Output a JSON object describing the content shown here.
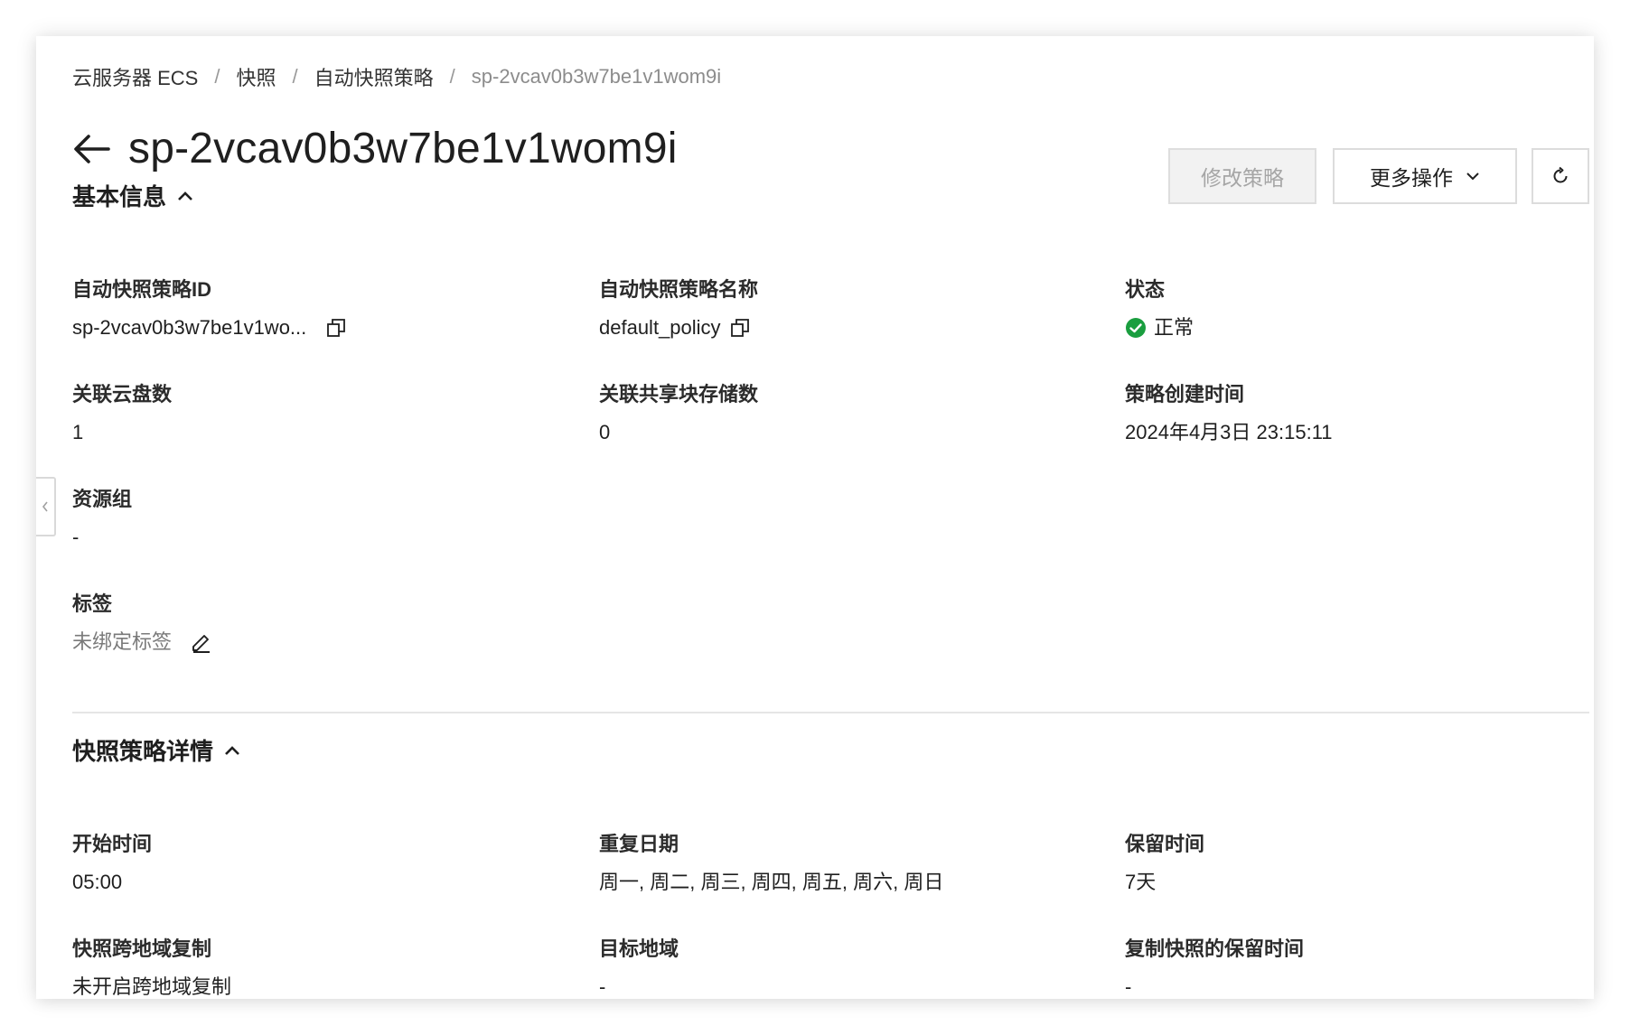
{
  "breadcrumb": {
    "items": [
      "云服务器 ECS",
      "快照",
      "自动快照策略"
    ],
    "current": "sp-2vcav0b3w7be1v1wom9i",
    "separator": "/"
  },
  "header": {
    "title": "sp-2vcav0b3w7be1v1wom9i",
    "edit_button": "修改策略",
    "more_button": "更多操作"
  },
  "basic_info": {
    "title": "基本信息",
    "fields": {
      "policy_id": {
        "label": "自动快照策略ID",
        "value": "sp-2vcav0b3w7be1v1wo..."
      },
      "policy_name": {
        "label": "自动快照策略名称",
        "value": "default_policy"
      },
      "status": {
        "label": "状态",
        "value": "正常"
      },
      "disk_count": {
        "label": "关联云盘数",
        "value": "1"
      },
      "shared_block_count": {
        "label": "关联共享块存储数",
        "value": "0"
      },
      "created_time": {
        "label": "策略创建时间",
        "value": "2024年4月3日 23:15:11"
      },
      "resource_group": {
        "label": "资源组",
        "value": "-"
      },
      "tags": {
        "label": "标签",
        "value": "未绑定标签"
      }
    }
  },
  "policy_detail": {
    "title": "快照策略详情",
    "fields": {
      "start_time": {
        "label": "开始时间",
        "value": "05:00"
      },
      "repeat_days": {
        "label": "重复日期",
        "value": "周一, 周二, 周三, 周四, 周五, 周六, 周日"
      },
      "retention": {
        "label": "保留时间",
        "value": "7天"
      },
      "cross_region": {
        "label": "快照跨地域复制",
        "value": "未开启跨地域复制"
      },
      "target_region": {
        "label": "目标地域",
        "value": "-"
      },
      "copy_retention": {
        "label": "复制快照的保留时间",
        "value": "-"
      }
    }
  },
  "colors": {
    "status_ok": "#1a9e3f",
    "border": "#dcdcdc",
    "disabled_bg": "#f2f2f2"
  },
  "icons": {
    "back": "arrow-left-icon",
    "copy": "copy-icon",
    "edit": "edit-icon",
    "refresh": "refresh-icon",
    "chevron": "chevron-down-icon",
    "collapse": "caret-up-icon",
    "status": "check-circle-icon",
    "sidebar_toggle": "chevron-left-icon"
  }
}
